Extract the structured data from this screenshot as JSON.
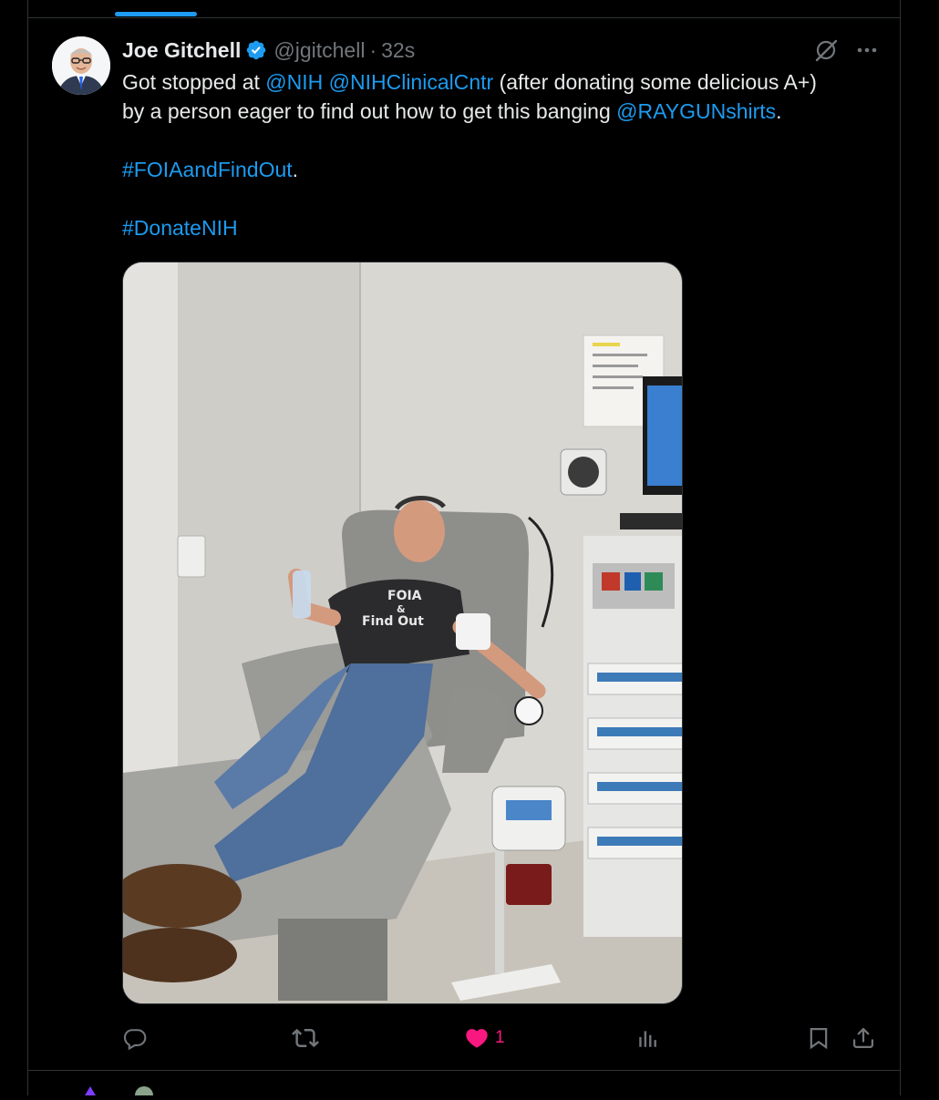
{
  "colors": {
    "accent": "#1d9bf0",
    "like": "#f91880",
    "muted": "#71767b",
    "text": "#e7e9ea",
    "background": "#000000",
    "border": "#2f3336"
  },
  "tweet": {
    "author": {
      "name": "Joe Gitchell",
      "handle": "@jgitchell",
      "verified": true
    },
    "separator": "·",
    "time": "32s",
    "text": {
      "line1_prefix": "Got stopped at ",
      "mention_nih": "@NIH",
      "space1": " ",
      "mention_clinical": "@NIHClinicalCntr",
      "line1_suffix": " (after donating some delicious A+)",
      "line2_prefix": "by a person eager to find out how to get this banging ",
      "mention_raygun": "@RAYGUNshirts",
      "line2_suffix": ".",
      "hashtag_foia": "#FOIAandFindOut",
      "hashtag_foia_suffix": ".",
      "hashtag_donate": "#DonateNIH"
    },
    "image": {
      "shirt_text_line1": "FOIA",
      "shirt_text_line2": "&",
      "shirt_text_line3": "Find Out"
    },
    "actions": {
      "reply_icon": "reply-icon",
      "retweet_icon": "retweet-icon",
      "like_icon": "heart-filled-icon",
      "like_count": "1",
      "views_icon": "bar-chart-icon",
      "bookmark_icon": "bookmark-icon",
      "share_icon": "share-icon"
    },
    "header_icons": [
      "grok-icon",
      "more-icon"
    ]
  }
}
